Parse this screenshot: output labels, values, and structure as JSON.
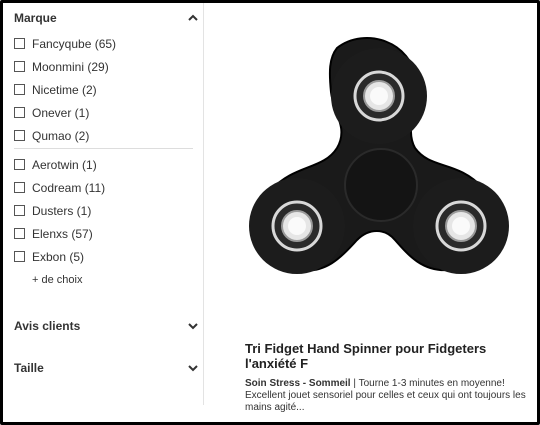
{
  "filters": {
    "brand": {
      "title": "Marque",
      "items_top": [
        {
          "label": "Fancyqube (65)"
        },
        {
          "label": "Moonmini (29)"
        },
        {
          "label": "Nicetime (2)"
        },
        {
          "label": "Onever (1)"
        },
        {
          "label": "Qumao (2)"
        }
      ],
      "items_bottom": [
        {
          "label": "Aerotwin (1)"
        },
        {
          "label": "Codream (11)"
        },
        {
          "label": "Dusters (1)"
        },
        {
          "label": "Elenxs (57)"
        },
        {
          "label": "Exbon (5)"
        }
      ],
      "more_label": "+ de choix"
    },
    "reviews": {
      "title": "Avis clients"
    },
    "size": {
      "title": "Taille"
    }
  },
  "product": {
    "title": "Tri Fidget Hand Spinner pour Fidgeters l'anxiété F",
    "desc_bold": "Soin Stress - Sommeil",
    "desc_text": " | Tourne 1-3 minutes en moyenne! Excellent jouet sensoriel pour celles et ceux qui ont toujours les mains agité..."
  },
  "colors": {
    "spinner_body": "#1a1a1a",
    "bearing_ring": "#d8d8d8",
    "text": "#333333"
  }
}
